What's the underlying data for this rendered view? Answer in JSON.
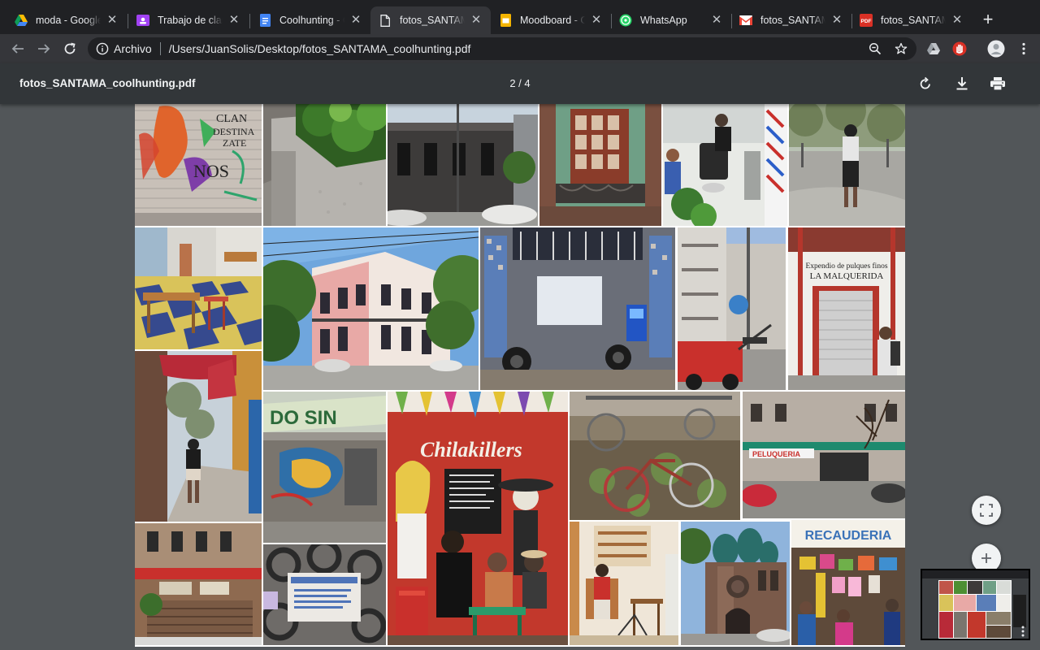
{
  "tabs": [
    {
      "title": "moda - Google Drive",
      "icon": "google-drive-icon",
      "active": false
    },
    {
      "title": "Trabajo de clase",
      "icon": "classroom-icon",
      "active": false
    },
    {
      "title": "Coolhunting - Google Docs",
      "icon": "docs-icon",
      "active": false
    },
    {
      "title": "fotos_SANTAMA_coolhunting.pdf",
      "icon": "file-icon",
      "active": true
    },
    {
      "title": "Moodboard - Google Slides",
      "icon": "slides-icon",
      "active": false
    },
    {
      "title": "WhatsApp",
      "icon": "whatsapp-icon",
      "active": false
    },
    {
      "title": "fotos_SANTAMA",
      "icon": "gmail-icon",
      "active": false
    },
    {
      "title": "fotos_SANTAMA",
      "icon": "pdf-icon",
      "active": false
    }
  ],
  "omnibox": {
    "scheme": "Archivo",
    "url": "/Users/JuanSolis/Desktop/fotos_SANTAMA_coolhunting.pdf"
  },
  "pdf": {
    "title": "fotos_SANTAMA_coolhunting.pdf",
    "page_counter": "2 / 4",
    "current_page": 2,
    "total_pages": 4
  },
  "photos": [
    {
      "name": "graffiti-shutter-photo",
      "text": "CLAN DESTINA ZATE"
    },
    {
      "name": "planter-photo"
    },
    {
      "name": "street-house-photo"
    },
    {
      "name": "green-window-photo"
    },
    {
      "name": "barbershop-photo"
    },
    {
      "name": "park-walker-photo"
    },
    {
      "name": "tiled-cafe-photo"
    },
    {
      "name": "corner-building-photo"
    },
    {
      "name": "mosaic-shopfront-photo"
    },
    {
      "name": "tow-truck-street-photo"
    },
    {
      "name": "pulqueria-photo",
      "text": "Expendio de pulques finos LA MALQUERIDA"
    },
    {
      "name": "sidewalk-awning-photo"
    },
    {
      "name": "painted-shutter-photo",
      "text": "DO SIN"
    },
    {
      "name": "chilakillers-mural-photo",
      "text": "Chilakillers"
    },
    {
      "name": "bicycle-garden-photo"
    },
    {
      "name": "peluqueria-street-photo",
      "text": "PELUQUERIA"
    },
    {
      "name": "red-shop-building-photo"
    },
    {
      "name": "ironwork-sign-photo"
    },
    {
      "name": "cafe-interior-photo"
    },
    {
      "name": "church-photo"
    },
    {
      "name": "recauderia-photo",
      "text": "RECAUDERIA"
    }
  ],
  "colors": {
    "tabstrip": "#202124",
    "toolbar": "#35363a",
    "pdf_bar": "#323639",
    "viewer_bg": "#525659"
  }
}
